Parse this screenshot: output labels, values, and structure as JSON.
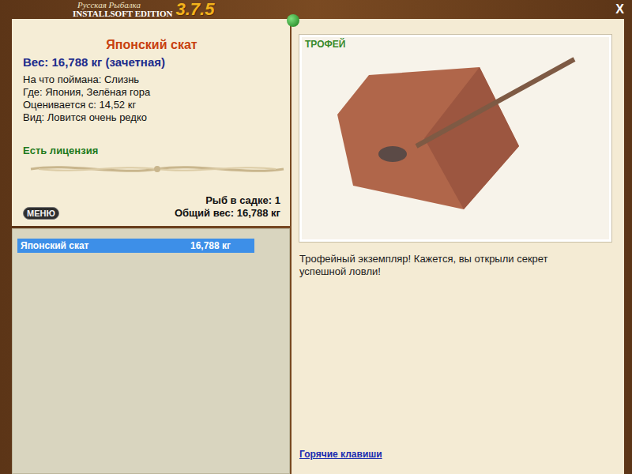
{
  "window": {
    "logo_top": "Русская Рыбалка",
    "logo_bottom": "INSTALLSOFT EDITION",
    "version": "3.7.5",
    "close": "X"
  },
  "fish": {
    "name": "Японский скат",
    "weight": "Вес: 16,788 кг (зачетная)",
    "details": [
      "На что поймана: Слизнь",
      "Где: Япония, Зелёная гора",
      "Оценивается с: 14,52 кг",
      "Вид: Ловится очень редко"
    ],
    "license": "Есть лицензия"
  },
  "keepnet": {
    "count": "Рыб в садке: 1",
    "total": "Общий вес: 16,788 кг"
  },
  "menu_button": "МЕНЮ",
  "catch_list": [
    {
      "name": "Японский скат",
      "weight": "16,788 кг",
      "selected": true
    }
  ],
  "trophy": {
    "badge": "ТРОФЕЙ",
    "message": "Трофейный экземпляр! Кажется, вы открыли секрет успешной ловли!"
  },
  "hotkeys_link": "Горячие клавиши"
}
